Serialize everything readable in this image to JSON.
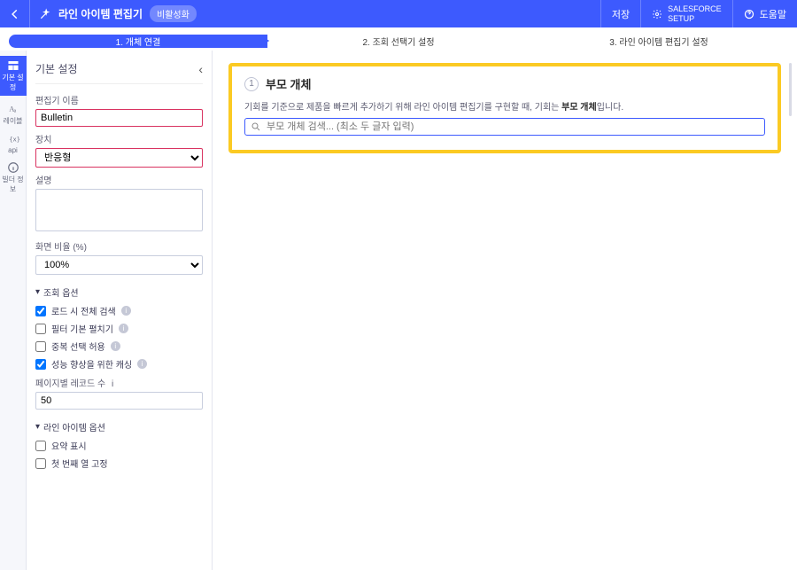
{
  "topbar": {
    "title": "라인 아이템 편집기",
    "badge": "비활성화",
    "save": "저장",
    "setup_line1": "SALESFORCE",
    "setup_line2": "SETUP",
    "help": "도움말"
  },
  "stepper": {
    "s1": "1. 개체 연결",
    "s2": "2. 조회 선택기 설정",
    "s3": "3. 라인 아이템 편집기 설정"
  },
  "rail": {
    "basic": "기본 설정",
    "labels": "레이블",
    "api": "api",
    "builder": "빌더 정보"
  },
  "sidebar": {
    "heading": "기본 설정",
    "editor_name_label": "편집기 이름",
    "editor_name_value": "Bulletin",
    "device_label": "장치",
    "device_value": "반응형",
    "desc_label": "설명",
    "desc_value": "",
    "ratio_label": "화면 비율 (%)",
    "ratio_value": "100%",
    "section_lookup": "조회 옵션",
    "chk_load_all": "로드 시 전체 검색",
    "chk_filter_expand": "필터 기본 펼치기",
    "chk_multi_select": "중복 선택 허용",
    "chk_perf_cache": "성능 향상을 위한 캐싱",
    "page_records_label": "페이지별 레코드 수",
    "page_records_value": "50",
    "section_line": "라인 아이템 옵션",
    "chk_summary": "요약 표시",
    "chk_first_col": "첫 번째 열 고정"
  },
  "main": {
    "step_num": "1",
    "step_title": "부모 개체",
    "desc_pre": "기회를 기준으로 제품을 빠르게 추가하기 위해 라인 아이템 편집기를 구현할 때, 기회는 ",
    "desc_bold": "부모 개체",
    "desc_post": "입니다.",
    "search_placeholder": "부모 개체 검색... (최소 두 글자 입력)"
  }
}
